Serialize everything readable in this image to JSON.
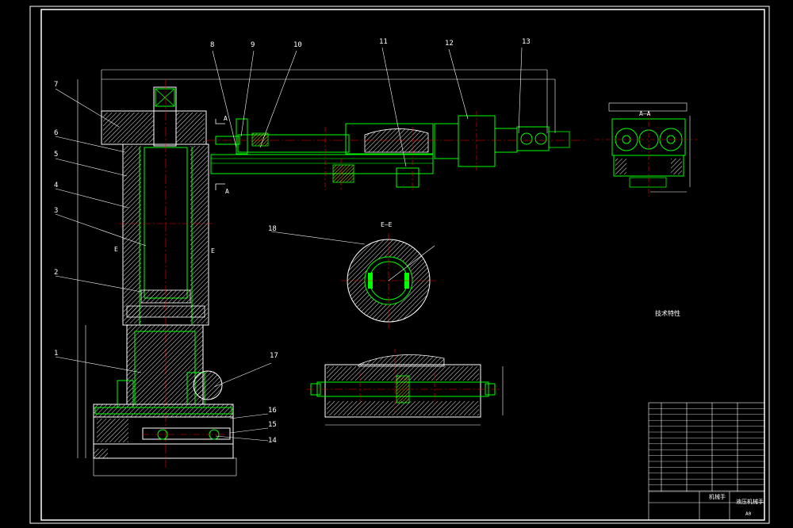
{
  "drawing": {
    "part_labels": [
      "1",
      "2",
      "3",
      "4",
      "5",
      "6",
      "7",
      "8",
      "9",
      "10",
      "11",
      "12",
      "13",
      "14",
      "15",
      "16",
      "17",
      "18"
    ],
    "section_labels": {
      "aa_top": "A—A",
      "ee_title": "E—E",
      "a_mark_top": "A",
      "a_mark_bottom": "A",
      "e_mark_left": "E",
      "e_mark_right": "E"
    },
    "tech_title": "技术特性",
    "title_block": {
      "name": "机械手",
      "subtitle": "液压机械手",
      "sheet": "A0"
    },
    "colors": {
      "background": "#000000",
      "outline": "#ffffff",
      "part": "#00ff00",
      "centerline": "#ff0000",
      "hatch": "#ffff00",
      "dimension": "#ffffff"
    }
  }
}
